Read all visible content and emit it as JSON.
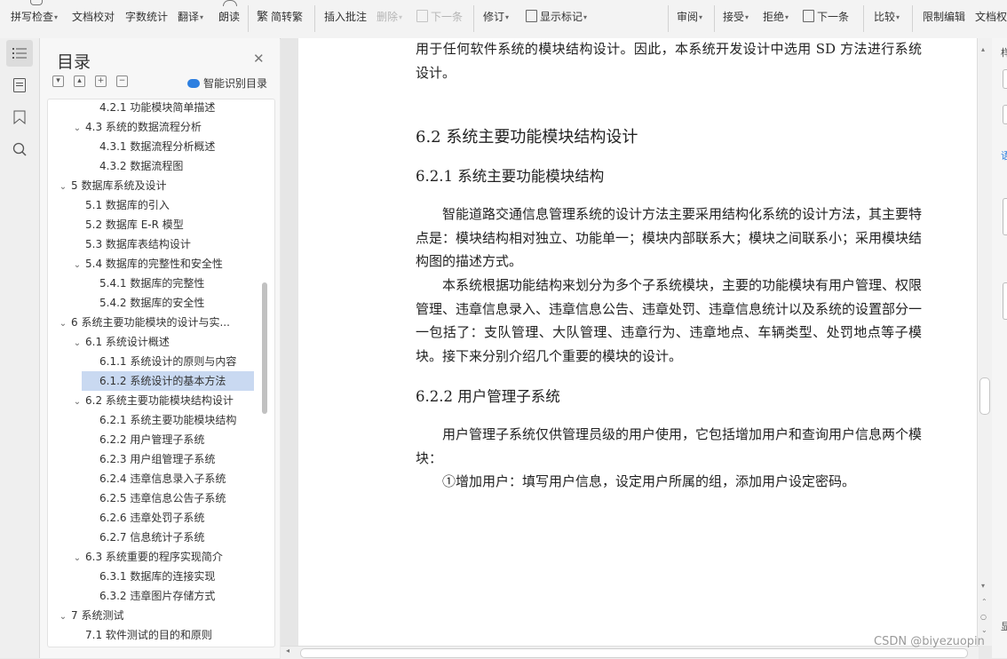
{
  "ribbon": {
    "spell_check": "拼写检查",
    "doc_proof": "文档校对",
    "word_count": "字数统计",
    "translate": "翻译",
    "read_aloud": "朗读",
    "simp_trad": "简转繁",
    "insert_comment": "插入批注",
    "delete": "删除",
    "next_item": "下一条",
    "revise": "修订",
    "show_markup": "显示标记",
    "review": "审阅",
    "accept": "接受",
    "reject": "拒绝",
    "next_change": "下一条",
    "compare": "比较",
    "restrict_edit": "限制编辑",
    "doc_rights": "文档权"
  },
  "toc": {
    "title": "目录",
    "smart_recognize": "智能识别目录",
    "items": [
      {
        "label": "4.2.1  功能模块简单描述",
        "level": 3,
        "expanded": null,
        "selected": false
      },
      {
        "label": "4.3  系统的数据流程分析",
        "level": 2,
        "expanded": true,
        "selected": false
      },
      {
        "label": "4.3.1  数据流程分析概述",
        "level": 3,
        "expanded": null,
        "selected": false
      },
      {
        "label": "4.3.2  数据流程图",
        "level": 3,
        "expanded": null,
        "selected": false
      },
      {
        "label": "5    数据库系统及设计",
        "level": 1,
        "expanded": true,
        "selected": false
      },
      {
        "label": "5.1  数据库的引入",
        "level": 2,
        "expanded": null,
        "selected": false
      },
      {
        "label": "5.2  数据库 E-R 模型",
        "level": 2,
        "expanded": null,
        "selected": false
      },
      {
        "label": "5.3  数据库表结构设计",
        "level": 2,
        "expanded": null,
        "selected": false
      },
      {
        "label": "5.4  数据库的完整性和安全性",
        "level": 2,
        "expanded": true,
        "selected": false
      },
      {
        "label": "5.4.1  数据库的完整性",
        "level": 3,
        "expanded": null,
        "selected": false
      },
      {
        "label": "5.4.2  数据库的安全性",
        "level": 3,
        "expanded": null,
        "selected": false
      },
      {
        "label": "6    系统主要功能模块的设计与实...",
        "level": 1,
        "expanded": true,
        "selected": false
      },
      {
        "label": "6.1  系统设计概述",
        "level": 2,
        "expanded": true,
        "selected": false
      },
      {
        "label": "6.1.1  系统设计的原则与内容",
        "level": 3,
        "expanded": null,
        "selected": false
      },
      {
        "label": "6.1.2  系统设计的基本方法",
        "level": 3,
        "expanded": null,
        "selected": true
      },
      {
        "label": "6.2  系统主要功能模块结构设计",
        "level": 2,
        "expanded": true,
        "selected": false
      },
      {
        "label": "6.2.1  系统主要功能模块结构",
        "level": 3,
        "expanded": null,
        "selected": false
      },
      {
        "label": "6.2.2  用户管理子系统",
        "level": 3,
        "expanded": null,
        "selected": false
      },
      {
        "label": "6.2.3  用户组管理子系统",
        "level": 3,
        "expanded": null,
        "selected": false
      },
      {
        "label": "6.2.4  违章信息录入子系统",
        "level": 3,
        "expanded": null,
        "selected": false
      },
      {
        "label": "6.2.5  违章信息公告子系统",
        "level": 3,
        "expanded": null,
        "selected": false
      },
      {
        "label": "6.2.6  违章处罚子系统",
        "level": 3,
        "expanded": null,
        "selected": false
      },
      {
        "label": "6.2.7  信息统计子系统",
        "level": 3,
        "expanded": null,
        "selected": false
      },
      {
        "label": "6.3 系统重要的程序实现简介",
        "level": 2,
        "expanded": true,
        "selected": false
      },
      {
        "label": "6.3.1  数据库的连接实现",
        "level": 3,
        "expanded": null,
        "selected": false
      },
      {
        "label": "6.3.2  违章图片存储方式",
        "level": 3,
        "expanded": null,
        "selected": false
      },
      {
        "label": "7    系统测试",
        "level": 1,
        "expanded": true,
        "selected": false
      },
      {
        "label": "7.1  软件测试的目的和原则",
        "level": 2,
        "expanded": null,
        "selected": false
      }
    ]
  },
  "document": {
    "intro": "用于任何软件系统的模块结构设计。因此，本系统开发设计中选用 SD 方法进行系统设计。",
    "h_6_2": "6.2  系统主要功能模块结构设计",
    "h_6_2_1": "6.2.1  系统主要功能模块结构",
    "para1": "智能道路交通信息管理系统的设计方法主要采用结构化系统的设计方法，其主要特点是：模块结构相对独立、功能单一；模块内部联系大；模块之间联系小；采用模块结构图的描述方式。",
    "para2": "本系统根据功能结构来划分为多个子系统模块，主要的功能模块有用户管理、权限管理、违章信息录入、违章信息公告、违章处罚、违章信息统计以及系统的设置部分一一包括了：支队管理、大队管理、违章行为、违章地点、车辆类型、处罚地点等子模块。接下来分别介绍几个重要的模块的设计。",
    "h_6_2_2": "6.2.2  用户管理子系统",
    "para3": "用户管理子系统仅供管理员级的用户使用，它包括增加用户和查询用户信息两个模块：",
    "para4": "①增加用户：填写用户信息，设定用户所属的组，添加用户设定密码。"
  },
  "watermark": "CSDN @biyezuopin",
  "right_panel": {
    "label_top": "样",
    "label_mid": "语",
    "label_bottom": "显"
  }
}
